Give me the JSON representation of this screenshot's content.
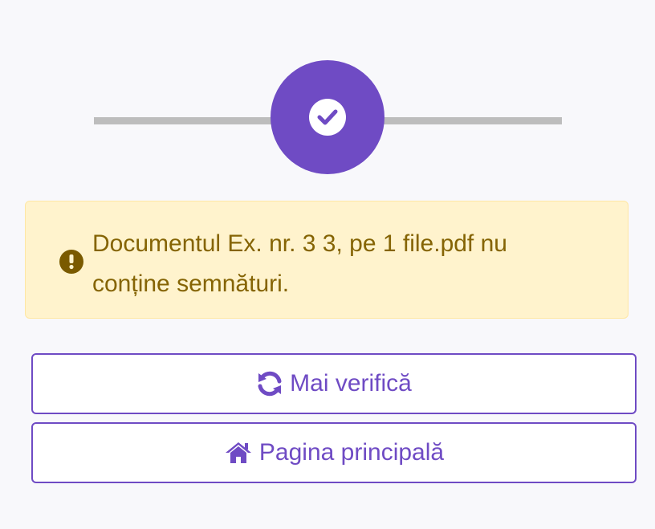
{
  "stepper": {
    "status": "complete",
    "accent_color": "#6f4bc4"
  },
  "alert": {
    "type": "warning",
    "icon": "exclamation-circle-icon",
    "message": "Documentul Ex. nr. 3 3, pe 1 file.pdf nu conține semnături."
  },
  "buttons": {
    "retry": {
      "icon": "sync-icon",
      "label": "Mai verifică"
    },
    "home": {
      "icon": "home-icon",
      "label": "Pagina principală"
    }
  }
}
